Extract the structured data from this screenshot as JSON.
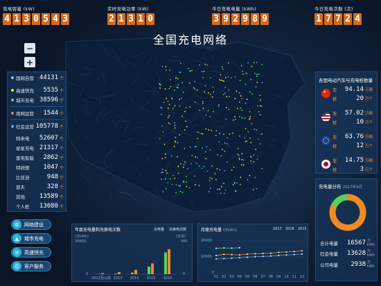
{
  "stats": [
    {
      "label": "充电容量 (kW)",
      "digits": [
        "4",
        "1",
        "3",
        "0",
        "5",
        "4",
        "3"
      ]
    },
    {
      "label": "实时充电功率 (kW)",
      "digits": [
        "2",
        "1",
        "3",
        "1",
        "0"
      ]
    },
    {
      "label": "今日充电电量 (kWh)",
      "digits": [
        "3",
        "9",
        "2",
        "9",
        "8",
        "9"
      ]
    },
    {
      "label": "今日充电次数 (次)",
      "digits": [
        "1",
        "7",
        "7",
        "2",
        "4"
      ]
    }
  ],
  "title": "全国充电网络",
  "zoom": {
    "out": "−",
    "in": "+"
  },
  "left_stats": [
    {
      "name": "国网自营",
      "value": "44131",
      "unit": "个",
      "color": "#9bb7d8"
    },
    {
      "name": "高速快充",
      "value": "5535",
      "unit": "个",
      "color": "#f1df3e"
    },
    {
      "name": "城市充电",
      "value": "38596",
      "unit": "个",
      "color": "#5ee06a"
    },
    {
      "name": "南网运营",
      "value": "1544",
      "unit": "个",
      "color": "#ef7b4d"
    },
    {
      "name": "社会运营",
      "value": "105778",
      "unit": "个",
      "color": "#55aee8"
    },
    {
      "name": "特来电",
      "value": "52607",
      "unit": "个"
    },
    {
      "name": "星星充电",
      "value": "21317",
      "unit": "个"
    },
    {
      "name": "富电智能",
      "value": "2862",
      "unit": "个"
    },
    {
      "name": "特锐德",
      "value": "1047",
      "unit": "个"
    },
    {
      "name": "比亚迪",
      "value": "948",
      "unit": "个"
    },
    {
      "name": "普天",
      "value": "328",
      "unit": "个"
    },
    {
      "name": "其他",
      "value": "13589",
      "unit": "个"
    },
    {
      "name": "个人桩",
      "value": "13080",
      "unit": "个"
    }
  ],
  "buttons": [
    "网络建设",
    "城市充电",
    "高速快充",
    "客户服务"
  ],
  "countries": {
    "title": "各国电动汽车与充电桩数量",
    "items": [
      {
        "flag": "china",
        "car": "94.14",
        "pile": "20"
      },
      {
        "flag": "usa",
        "car": "57.02",
        "pile": "10"
      },
      {
        "flag": "eu",
        "car": "63.76",
        "pile": "12"
      },
      {
        "flag": "japan",
        "car": "14.75",
        "pile": "3"
      }
    ],
    "car_label": "车",
    "pile_label": "桩",
    "car_unit": "万辆",
    "pile_unit": "万个"
  },
  "distribution": {
    "title": "充电量分布",
    "subtitle": "2017年4月",
    "items": [
      {
        "name": "合计电量",
        "value": "16567",
        "unit": "万kWh"
      },
      {
        "name": "社会电量",
        "value": "13628",
        "unit": "万kWh"
      },
      {
        "name": "公司电量",
        "value": "2938",
        "unit": "万kWh"
      }
    ],
    "ring": {
      "orange": 0.82,
      "green": 0.18
    }
  },
  "chart_data": [
    {
      "type": "bar",
      "title": "年度充电量和充换电次数",
      "legend": [
        "充电量",
        "充换电次数"
      ],
      "yunit_left": "(万kWh)",
      "yunit_right": "(万次)",
      "categories": [
        "2012及以前",
        "2013",
        "2014",
        "2015",
        "2016"
      ],
      "series": [
        {
          "name": "充电量",
          "values": [
            200,
            600,
            1500,
            7000,
            20000
          ]
        },
        {
          "name": "充换电次数",
          "values": [
            10,
            20,
            40,
            100,
            230
          ]
        }
      ],
      "ylim": [
        0,
        30000
      ],
      "ticks_left": [
        "30000",
        "0"
      ],
      "ticks_right": [
        "300",
        "0"
      ]
    },
    {
      "type": "line",
      "title": "月度充电量",
      "unit": "(万kWh)",
      "tabs": [
        "2017",
        "2016",
        "2015"
      ],
      "x": [
        "01",
        "02",
        "03",
        "04",
        "05",
        "06",
        "07",
        "08",
        "09",
        "10",
        "11",
        "12"
      ],
      "series": [
        {
          "name": "a",
          "values": [
            10800,
            11600,
            11400,
            11200,
            11700,
            11900,
            12100,
            12300,
            12800,
            13100,
            13300,
            13800
          ]
        },
        {
          "name": "b",
          "values": [
            8700,
            8900,
            9200,
            9400,
            9800,
            10100,
            10300,
            10500,
            10900,
            11200,
            11400,
            11800
          ]
        },
        {
          "name": "c",
          "values": [
            15400,
            15600,
            15500,
            15700
          ]
        }
      ],
      "ylim": [
        0,
        20000
      ],
      "ticks": [
        "20000",
        "10000",
        "0"
      ]
    }
  ]
}
